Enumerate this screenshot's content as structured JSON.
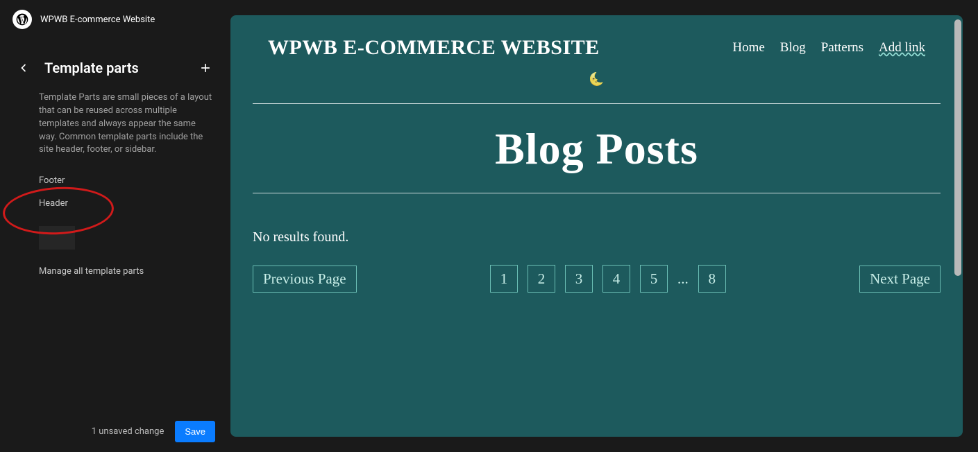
{
  "site": {
    "name": "WPWB E-commerce Website"
  },
  "sidebar": {
    "title": "Template parts",
    "description": "Template Parts are small pieces of a layout that can be reused across multiple templates and always appear the same way. Common template parts include the site header, footer, or sidebar.",
    "items": [
      {
        "label": "Footer"
      },
      {
        "label": "Header"
      }
    ],
    "manage": "Manage all template parts",
    "unsaved": "1 unsaved change",
    "save": "Save"
  },
  "preview": {
    "brand": "WPWB E-COMMERCE WEBSITE",
    "nav": {
      "home": "Home",
      "blog": "Blog",
      "patterns": "Patterns",
      "addlink": "Add link"
    },
    "hero": "Blog Posts",
    "no_results": "No results found.",
    "pager": {
      "prev": "Previous Page",
      "next": "Next Page",
      "p1": "1",
      "p2": "2",
      "p3": "3",
      "p4": "4",
      "p5": "5",
      "dots": "...",
      "p8": "8"
    }
  }
}
